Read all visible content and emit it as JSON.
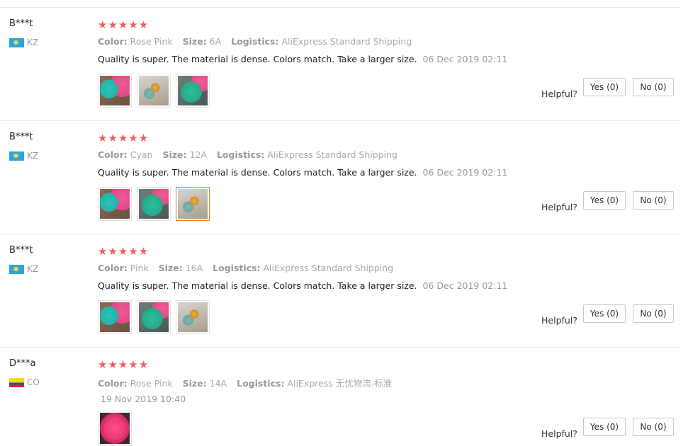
{
  "labels": {
    "color": "Color:",
    "size": "Size:",
    "logistics": "Logistics:",
    "helpful": "Helpful?"
  },
  "reviews": [
    {
      "user": "B***t",
      "country": "KZ",
      "flag": "kz-flag",
      "rating": 5,
      "stars": "★★★★★",
      "color": "Rose Pink",
      "size": "6A",
      "logistics": "AliExpress Standard Shipping",
      "text": "Quality is super. The material is dense. Colors match. Take a larger size.",
      "date": "06 Dec 2019 02:11",
      "photos": [
        "teal-pink-photo",
        "flowers-photo",
        "teal-photo"
      ],
      "yes": "Yes (0)",
      "no": "No (0)"
    },
    {
      "user": "B***t",
      "country": "KZ",
      "flag": "kz-flag",
      "rating": 5,
      "stars": "★★★★★",
      "color": "Cyan",
      "size": "12A",
      "logistics": "AliExpress Standard Shipping",
      "text": "Quality is super. The material is dense. Colors match. Take a larger size.",
      "date": "06 Dec 2019 02:11",
      "photos": [
        "teal-pink-photo",
        "teal-photo",
        "flowers-photo"
      ],
      "selected_photo_index": 2,
      "yes": "Yes (0)",
      "no": "No (0)"
    },
    {
      "user": "B***t",
      "country": "KZ",
      "flag": "kz-flag",
      "rating": 5,
      "stars": "★★★★★",
      "color": "Pink",
      "size": "16A",
      "logistics": "AliExpress Standard Shipping",
      "text": "Quality is super. The material is dense. Colors match. Take a larger size.",
      "date": "06 Dec 2019 02:11",
      "photos": [
        "teal-pink-photo",
        "teal-photo",
        "flowers-photo"
      ],
      "yes": "Yes (0)",
      "no": "No (0)"
    },
    {
      "user": "D***a",
      "country": "CO",
      "flag": "co-flag",
      "rating": 5,
      "stars": "★★★★★",
      "color": "Rose Pink",
      "size": "14A",
      "logistics": "AliExpress 无忧物流-标准",
      "date": "19 Nov 2019 10:40",
      "photos": [
        "pink-photo"
      ],
      "yes": "Yes (0)",
      "no": "No (0)"
    }
  ]
}
